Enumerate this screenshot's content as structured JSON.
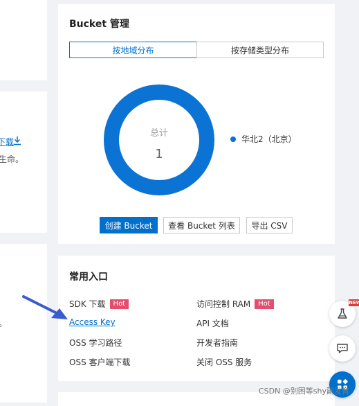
{
  "left_panel": {
    "partial_link": "下载",
    "partial_desc_1": "生命。",
    "partial_desc_2": "",
    "partial_text_3": "。"
  },
  "bucket_card": {
    "title": "Bucket 管理",
    "tabs": [
      {
        "label": "按地域分布",
        "active": true
      },
      {
        "label": "按存储类型分布",
        "active": false
      }
    ],
    "donut": {
      "center_label": "总计",
      "center_value": "1"
    },
    "buttons": {
      "create": "创建 Bucket",
      "list": "查看 Bucket 列表",
      "csv": "导出 CSV"
    }
  },
  "chart_data": {
    "type": "pie",
    "categories": [
      "华北2（北京）"
    ],
    "values": [
      1
    ],
    "center_label": "总计",
    "center_value": 1,
    "colors": [
      "#0a73d4"
    ],
    "legend_position": "right"
  },
  "entry_card": {
    "title": "常用入口",
    "left_column": [
      {
        "label": "SDK 下载",
        "badge": "Hot",
        "link": false
      },
      {
        "label": "Access Key",
        "badge": "",
        "link": true
      },
      {
        "label": "OSS 学习路径",
        "badge": "",
        "link": false
      },
      {
        "label": "OSS 客户端下载",
        "badge": "",
        "link": false
      }
    ],
    "right_column": [
      {
        "label": "访问控制 RAM",
        "badge": "Hot",
        "link": false
      },
      {
        "label": "API 文档",
        "badge": "",
        "link": false
      },
      {
        "label": "开发者指南",
        "badge": "",
        "link": false
      },
      {
        "label": "关闭 OSS 服务",
        "badge": "",
        "link": false
      }
    ]
  },
  "floating": {
    "new_badge": "NEW"
  },
  "watermark": "CSDN @别困等shy副发育",
  "colors": {
    "primary": "#0070cc",
    "donut": "#0a73d4",
    "hot": "#e54d6c",
    "arrow": "#3a5bd0"
  }
}
